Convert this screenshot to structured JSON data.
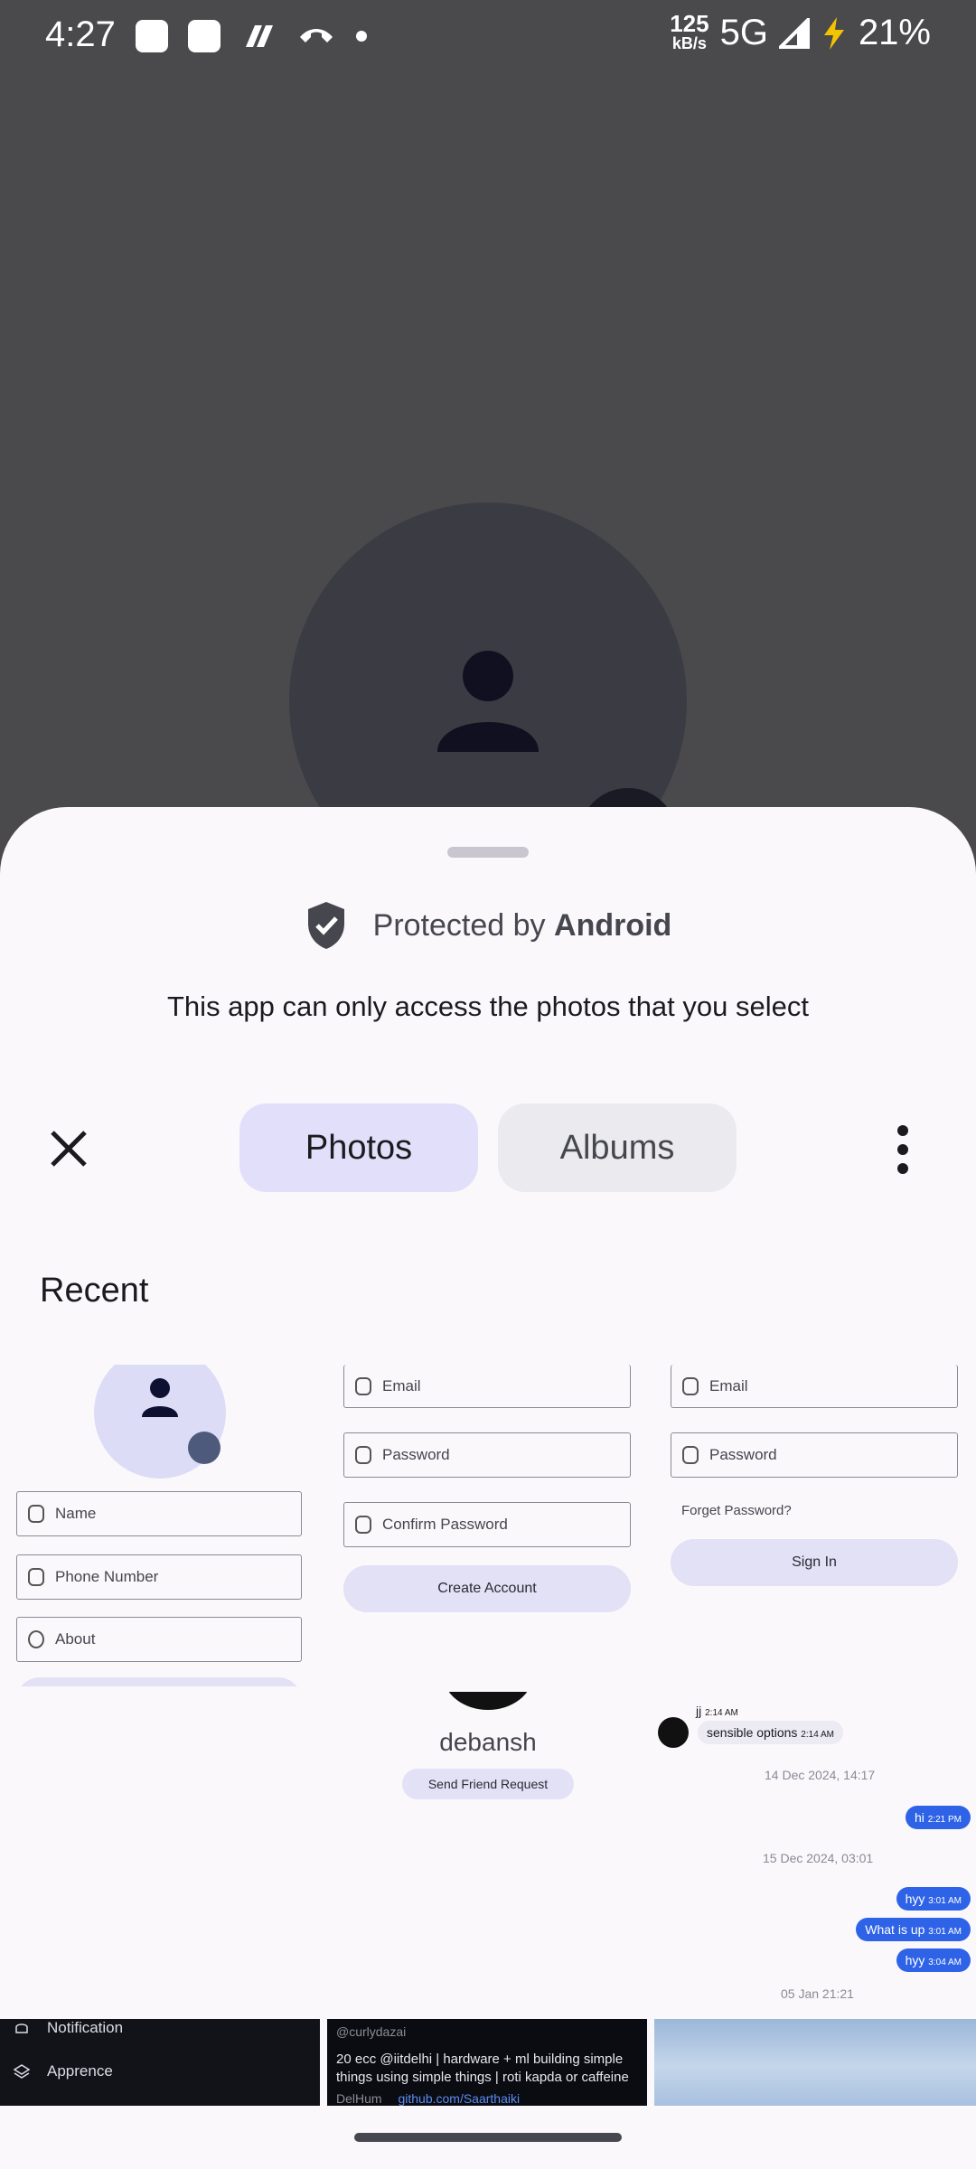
{
  "status_bar": {
    "time": "4:27",
    "speed_value": "125",
    "speed_unit": "kB/s",
    "network": "5G",
    "battery": "21%"
  },
  "sheet": {
    "protected_prefix": "Protected by",
    "protected_brand": "Android",
    "subtitle": "This app can only access the photos that you select",
    "tabs": [
      {
        "label": "Photos",
        "selected": true
      },
      {
        "label": "Albums",
        "selected": false
      }
    ],
    "section_title": "Recent"
  },
  "thumbnails": {
    "t1": {
      "fields": [
        "Name",
        "Phone Number",
        "About"
      ]
    },
    "t2": {
      "fields": [
        "Email",
        "Password",
        "Confirm Password"
      ],
      "button": "Create Account"
    },
    "t3": {
      "fields": [
        "Email",
        "Password"
      ],
      "forgot": "Forget Password?",
      "button": "Sign In"
    },
    "t5": {
      "name": "debansh",
      "button": "Send Friend Request"
    },
    "t6": {
      "msg1": "jj",
      "msg1_time": "2:14 AM",
      "msg2": "sensible options",
      "msg2_time": "2:14 AM",
      "date1": "14 Dec 2024, 14:17",
      "bubble1": "hi",
      "bubble1_time": "2:21 PM",
      "date2": "15 Dec 2024, 03:01",
      "bubble2": "hyy",
      "bubble2_time": "3:01 AM",
      "bubble3": "What is up",
      "bubble3_time": "3:01 AM",
      "bubble4": "hyy",
      "bubble4_time": "3:04 AM",
      "date3": "05 Jan 21:21"
    },
    "t7": {
      "items": [
        "Notification",
        "Apprence"
      ]
    },
    "t8": {
      "handle": "@curlydazai",
      "bio_line1": "20 ecc @iitdelhi | hardware + ml  building simple",
      "bio_line2": "things using simple things | roti kapda or caffeine",
      "location": "DelHum",
      "link": "github.com/Saarthaiki"
    }
  },
  "colors": {
    "scrim": "#4a4a4c",
    "sheet_bg": "#fbf8fc",
    "tab_selected": "#e2dffa",
    "tab_unselected": "#ebebef",
    "chat_bubble": "#2f63e7"
  }
}
